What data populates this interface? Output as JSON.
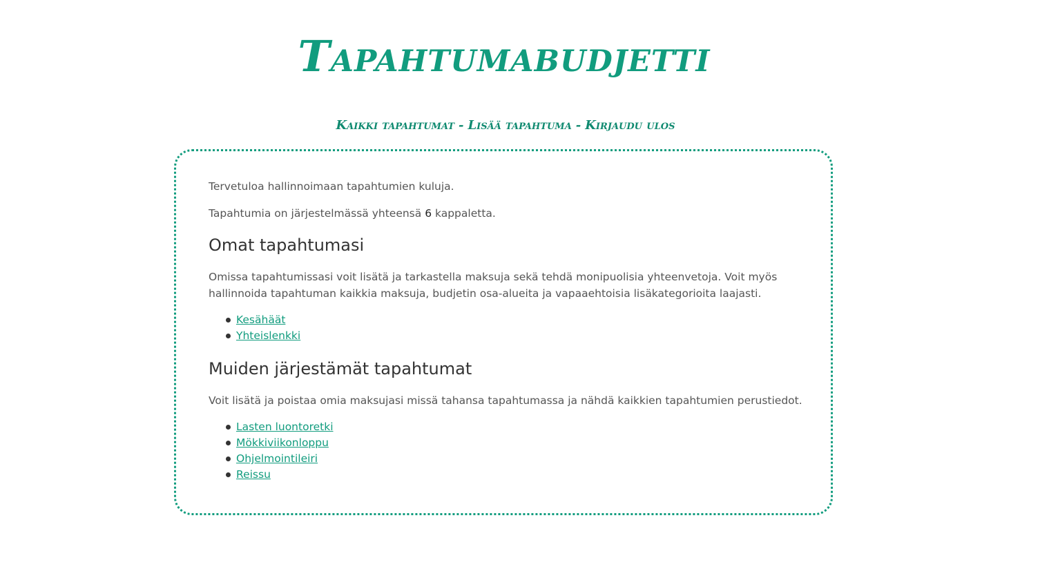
{
  "site": {
    "title": "Tapahtumabudjetti"
  },
  "nav": {
    "all_events": "Kaikki tapahtumat",
    "separator": "-",
    "add_event": "Lisää tapahtuma",
    "logout": "Kirjaudu ulos"
  },
  "main": {
    "welcome": "Tervetuloa hallinnoimaan tapahtumien kuluja.",
    "count_prefix": "Tapahtumia on järjestelmässä yhteensä",
    "count_value": "6",
    "count_suffix": "kappaletta.",
    "own_section": {
      "heading": "Omat tapahtumasi",
      "description": "Omissa tapahtumissasi voit lisätä ja tarkastella maksuja sekä tehdä monipuolisia yhteenvetoja. Voit myös hallinnoida tapahtuman kaikkia maksuja, budjetin osa-alueita ja vapaaehtoisia lisäkategorioita laajasti.",
      "events": [
        "Kesähäät",
        "Yhteislenkki"
      ]
    },
    "other_section": {
      "heading": "Muiden järjestämät tapahtumat",
      "description": "Voit lisätä ja poistaa omia maksujasi missä tahansa tapahtumassa ja nähdä kaikkien tapahtumien perustiedot.",
      "events": [
        "Lasten luontoretki",
        "Mökkiviikonloppu",
        "Ohjelmointileiri",
        "Reissu"
      ]
    }
  },
  "colors": {
    "accent": "#119c7e",
    "text": "#555555",
    "heading": "#333333"
  }
}
